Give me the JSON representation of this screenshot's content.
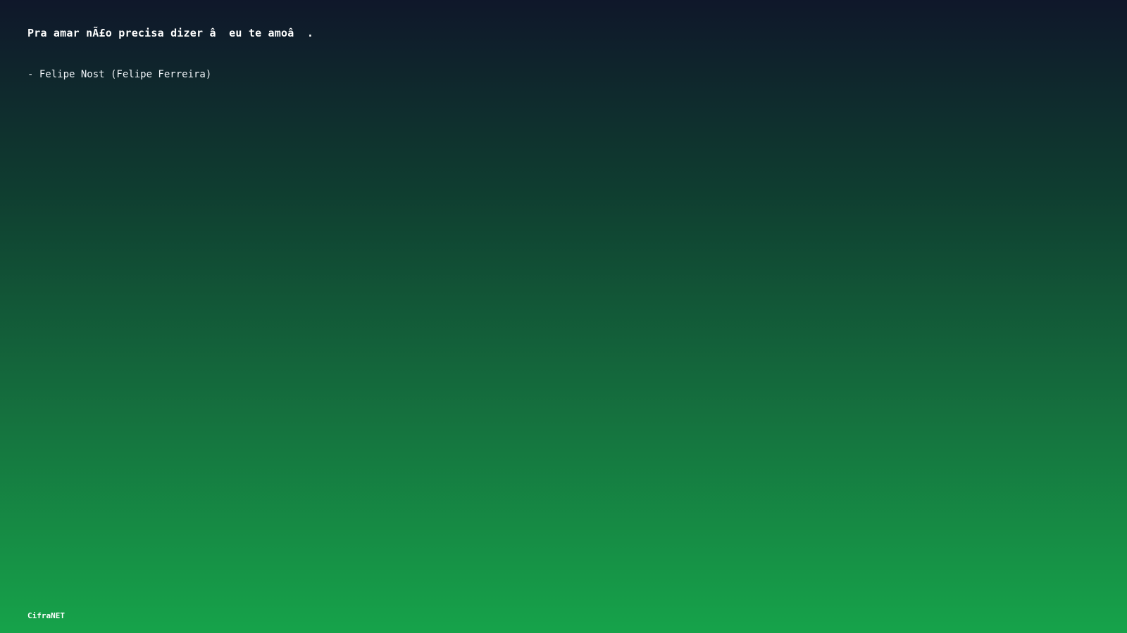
{
  "quote": {
    "text": "Pra amar nÃ£o precisa dizer â  eu te amoâ  ."
  },
  "author": {
    "text": "- Felipe Nost (Felipe Ferreira)"
  },
  "footer": {
    "brand": "CifraNET"
  },
  "colors": {
    "gradient_top": "#0f172a",
    "gradient_bottom": "#16a34a",
    "text": "#ffffff"
  }
}
